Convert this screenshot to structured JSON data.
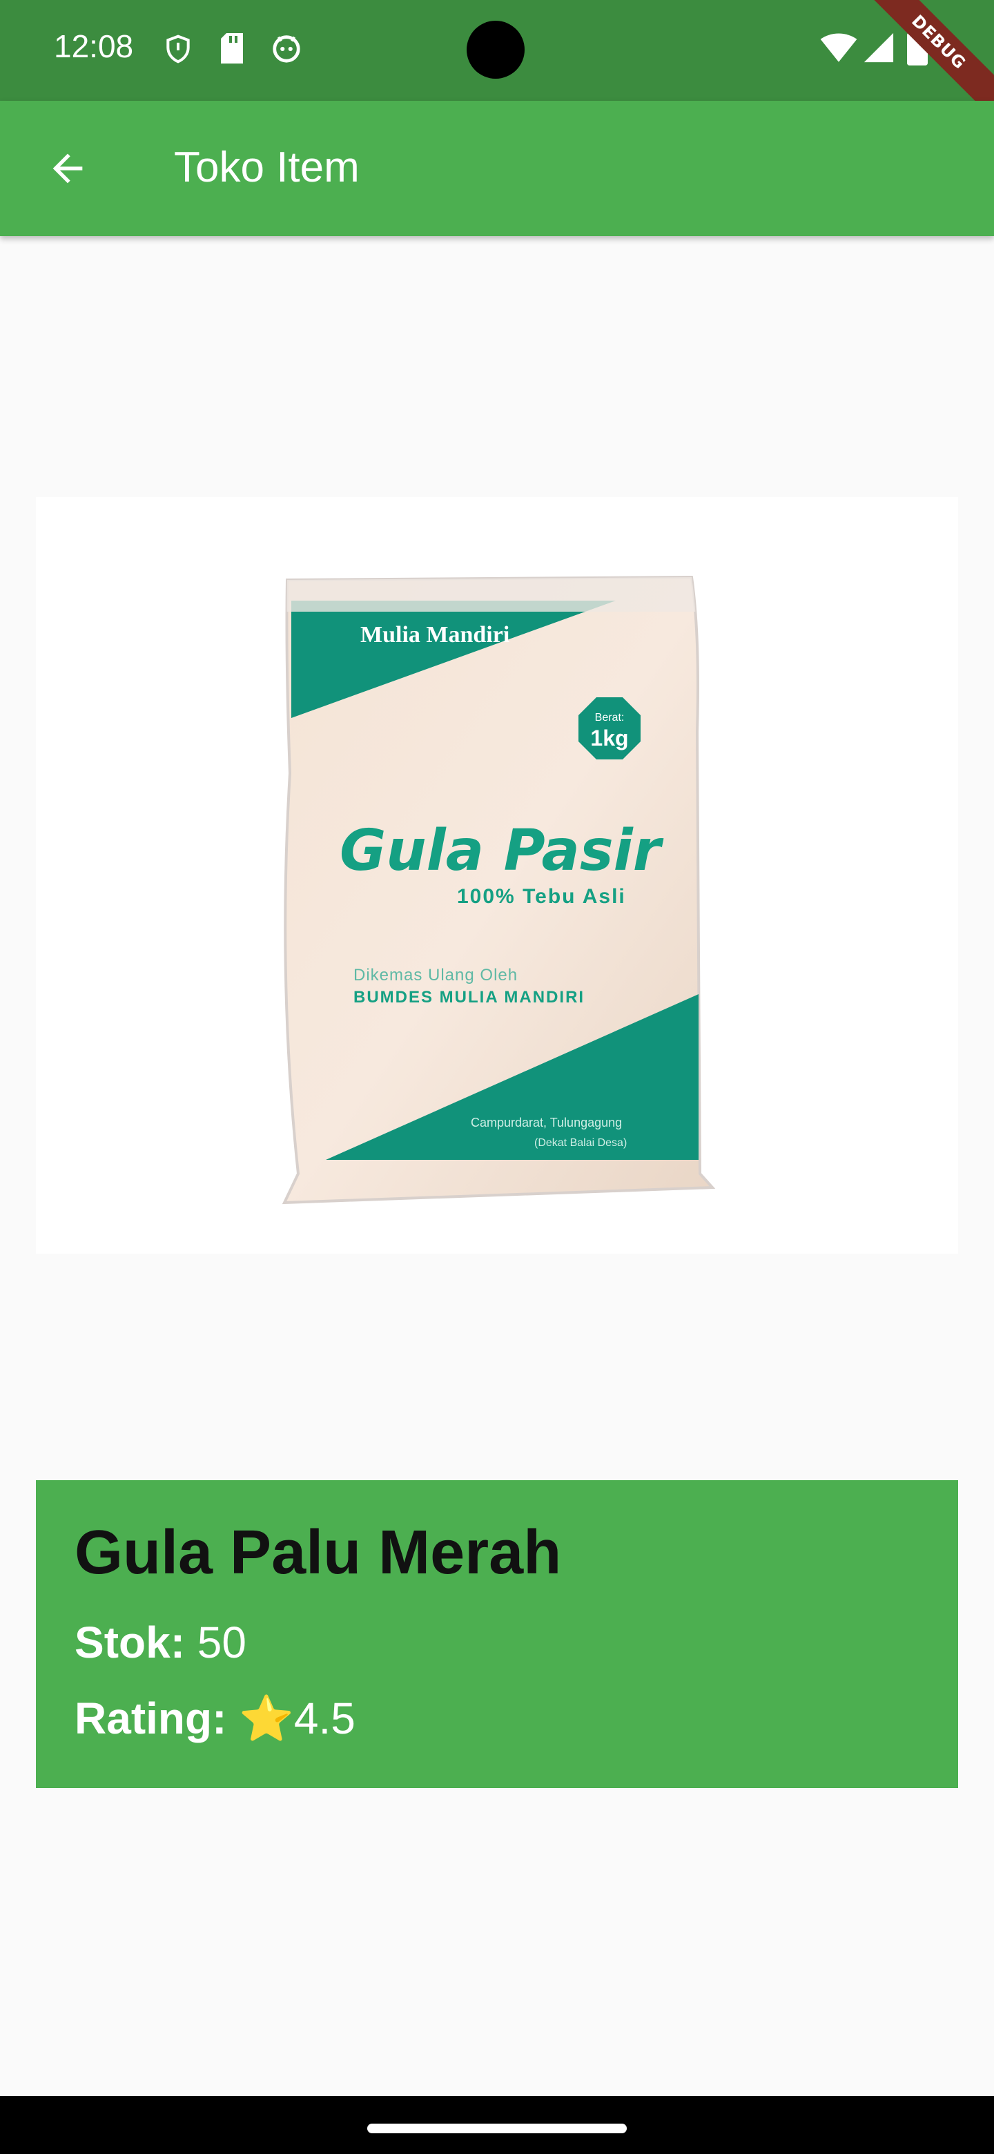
{
  "status_bar": {
    "time": "12:08",
    "icons_left": [
      "shield-icon",
      "sd-card-icon",
      "android-icon"
    ],
    "icons_right": [
      "wifi-icon",
      "cellular-signal-icon",
      "battery-icon"
    ],
    "debug_label": "DEBUG",
    "bg_color": "#3c8c3f"
  },
  "app_bar": {
    "title": "Toko Item",
    "back_icon": "arrow-back-icon",
    "bg_color": "#4caf50"
  },
  "product_image": {
    "brand": "Mulia Mandiri",
    "weight_label": "Berat:",
    "weight": "1kg",
    "name": "Gula Pasir",
    "tagline": "100% Tebu Asli",
    "packed_by_label": "Dikemas Ulang Oleh",
    "packed_by": "BUMDES MULIA MANDIRI",
    "location": "Campurdarat, Tulungagung",
    "location_note": "(Dekat Balai Desa)"
  },
  "product": {
    "name": "Gula Palu Merah",
    "stock_label": "Stok:",
    "stock_value": "50",
    "rating_label": "Rating:",
    "rating_star": "⭐",
    "rating_value": "4.5"
  }
}
